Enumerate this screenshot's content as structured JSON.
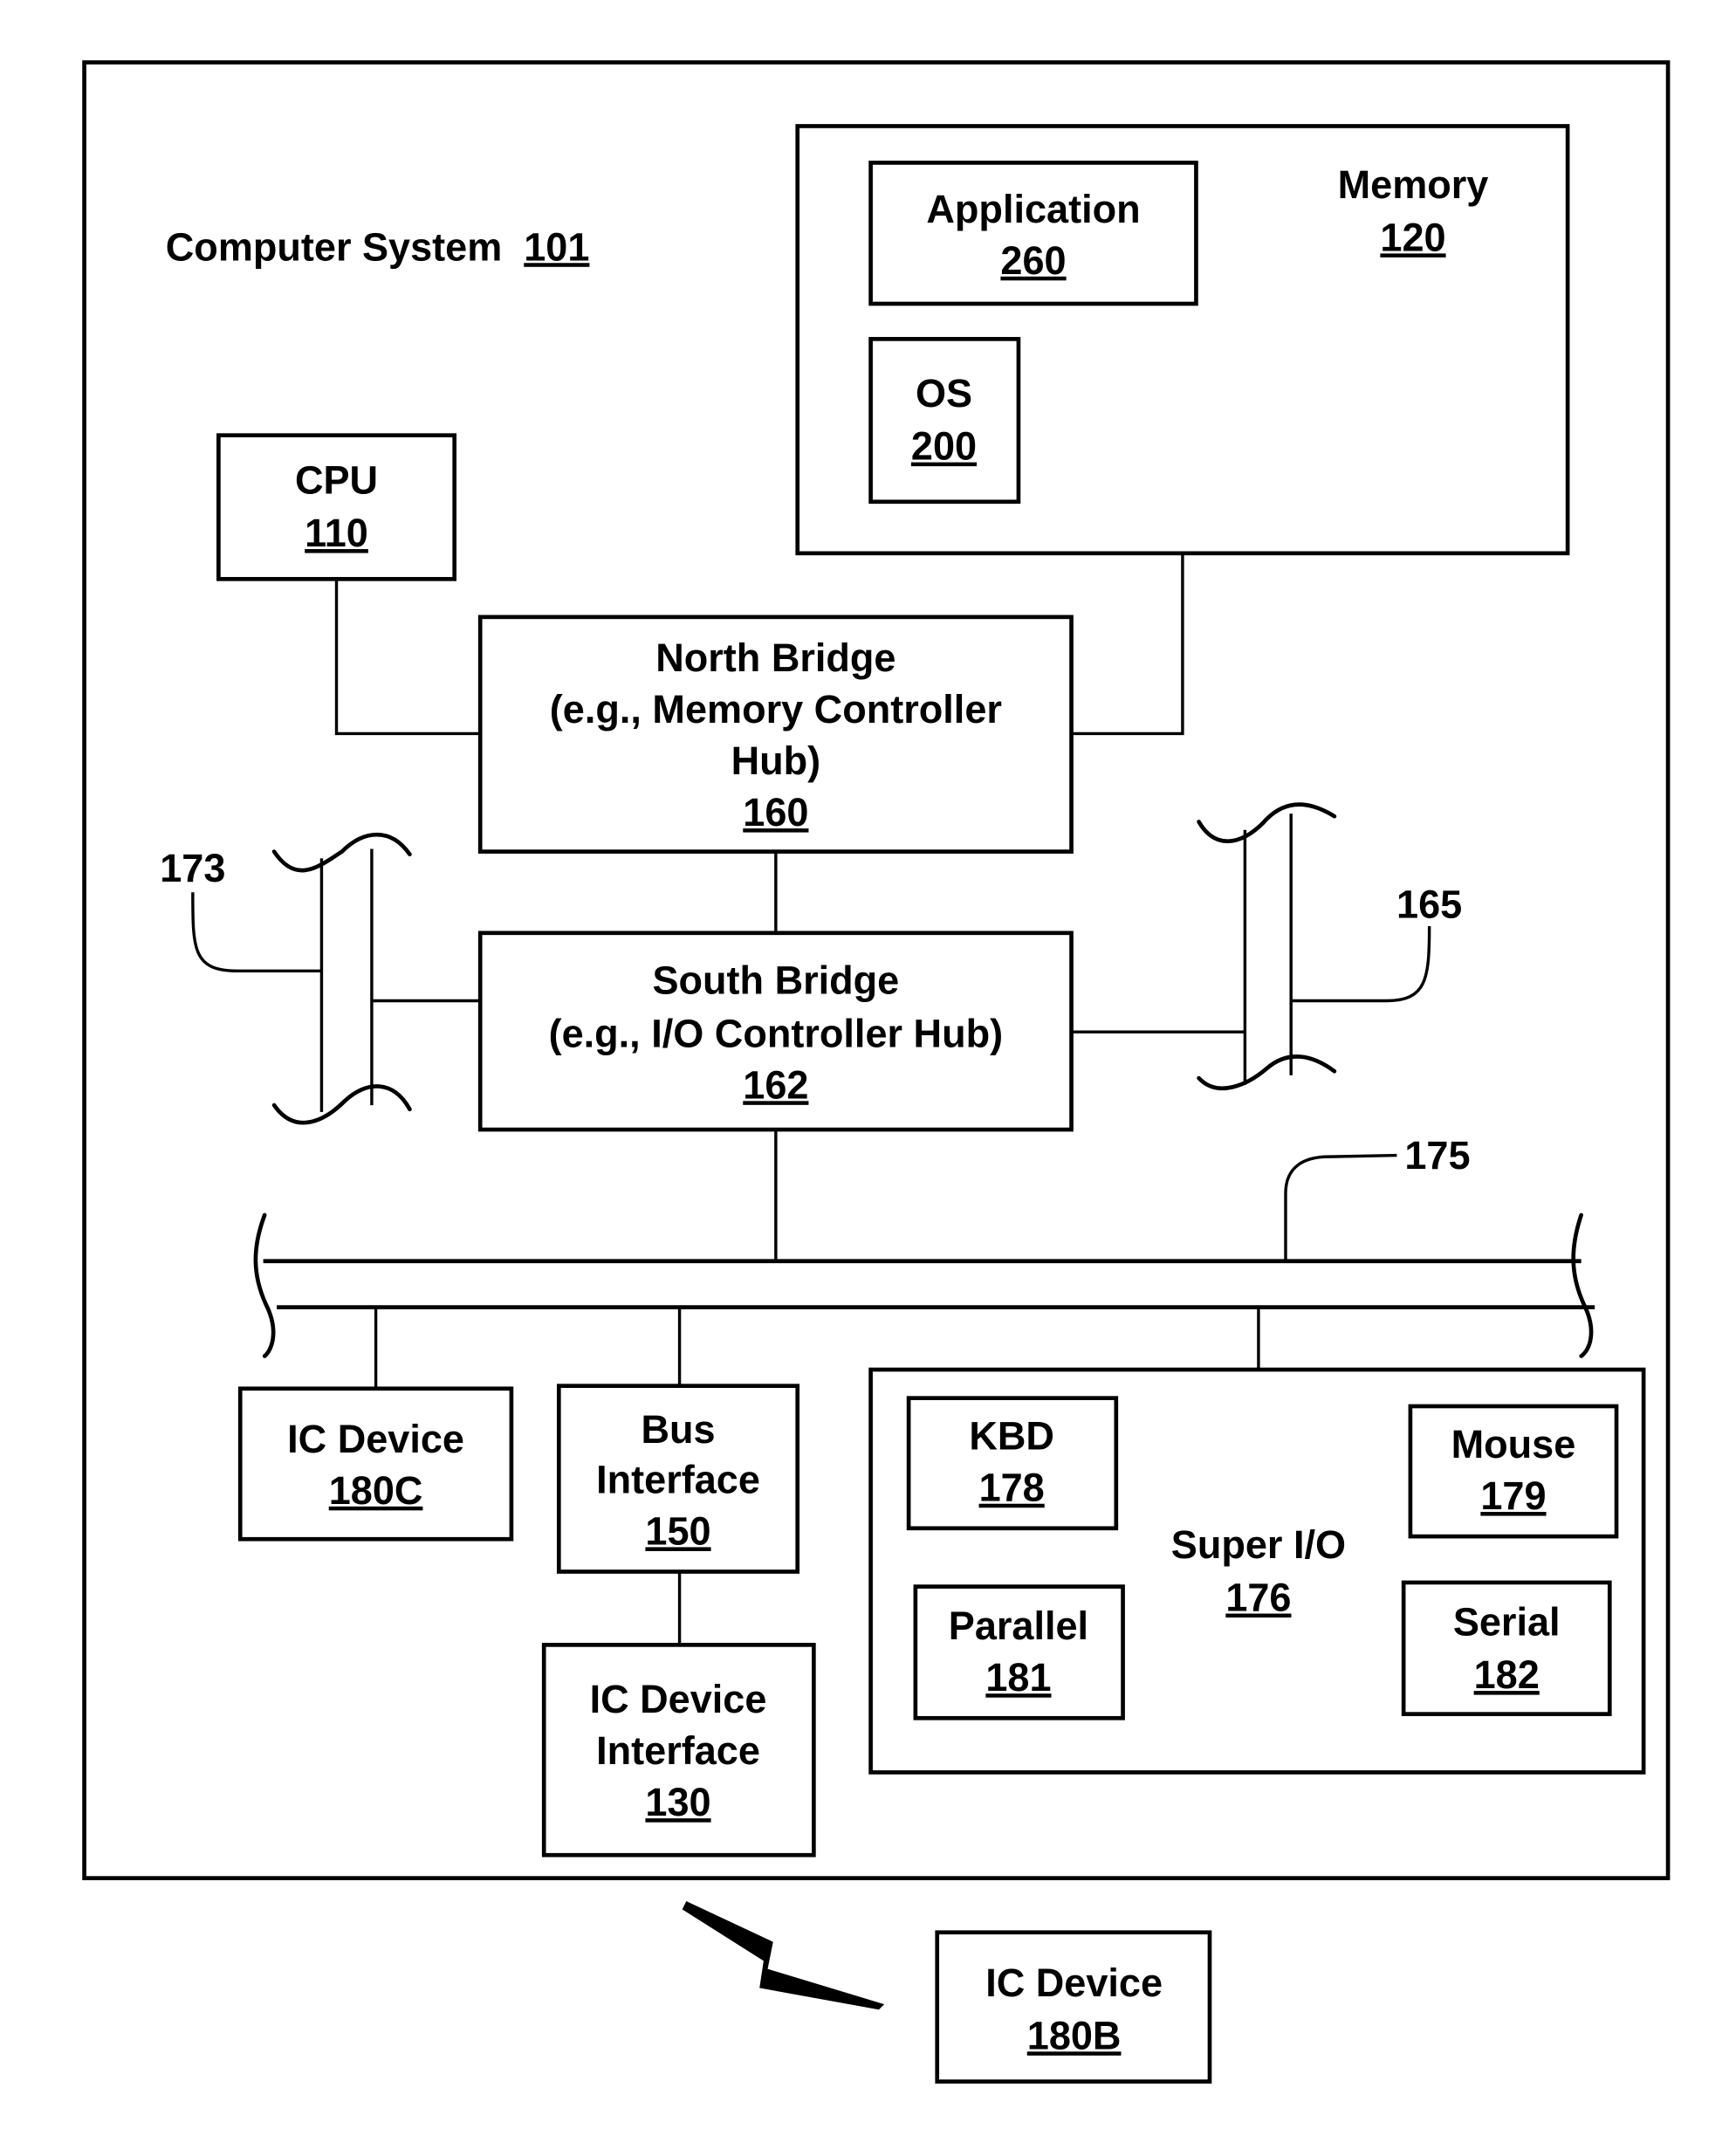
{
  "diagram": {
    "system": {
      "label": "Computer System",
      "ref": "101"
    },
    "memory": {
      "label": "Memory",
      "ref": "120"
    },
    "application": {
      "label": "Application",
      "ref": "260"
    },
    "os": {
      "label": "OS",
      "ref": "200"
    },
    "cpu": {
      "label": "CPU",
      "ref": "110"
    },
    "north_bridge": {
      "lines": [
        "North Bridge",
        "(e.g., Memory Controller",
        "Hub)"
      ],
      "ref": "160"
    },
    "south_bridge": {
      "lines": [
        "South Bridge",
        "(e.g., I/O Controller Hub)"
      ],
      "ref": "162"
    },
    "bus_labels": {
      "left_bus": "173",
      "right_bus": "165",
      "main_bus": "175"
    },
    "ic_device_c": {
      "lines": [
        "IC Device"
      ],
      "ref": "180C"
    },
    "bus_interface": {
      "lines": [
        "Bus",
        "Interface"
      ],
      "ref": "150"
    },
    "ic_device_interface": {
      "lines": [
        "IC Device",
        "Interface"
      ],
      "ref": "130"
    },
    "super_io": {
      "lines": [
        "Super I/O"
      ],
      "ref": "176"
    },
    "kbd": {
      "label": "KBD",
      "ref": "178"
    },
    "mouse": {
      "label": "Mouse",
      "ref": "179"
    },
    "parallel": {
      "label": "Parallel",
      "ref": "181"
    },
    "serial": {
      "label": "Serial",
      "ref": "182"
    },
    "ic_device_b": {
      "lines": [
        "IC Device"
      ],
      "ref": "180B"
    },
    "wireless_link": {
      "icon": "lightning-bolt-icon"
    }
  }
}
